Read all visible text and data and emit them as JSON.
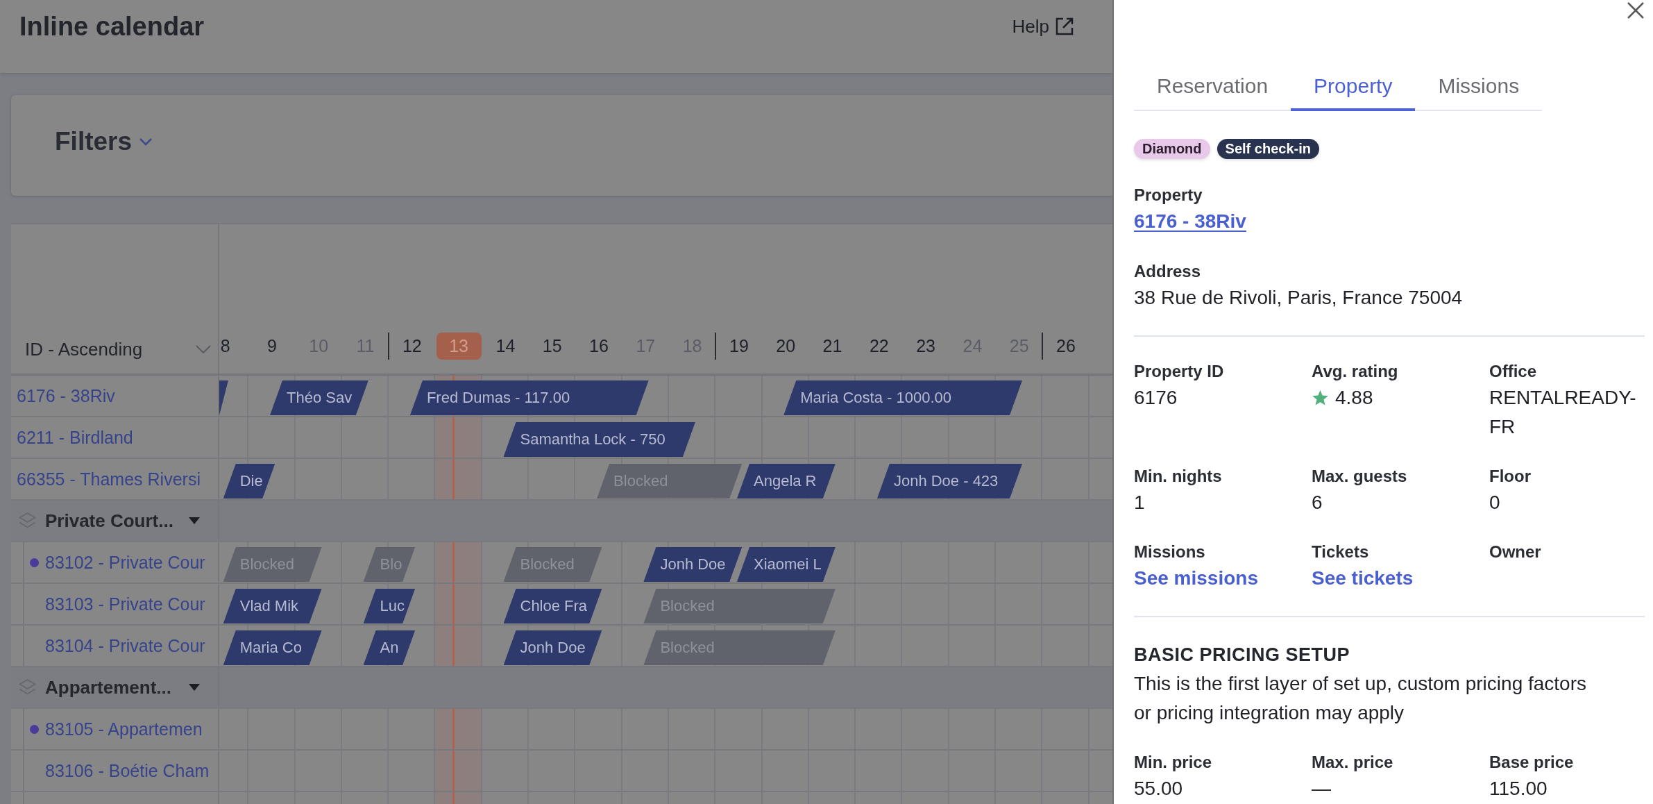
{
  "page": {
    "title": "Inline calendar",
    "help": "Help"
  },
  "filters": {
    "label": "Filters",
    "expanded": false
  },
  "calendar": {
    "sort": "ID - Ascending",
    "days": [
      {
        "label": "8",
        "weekend": false,
        "week_start": false,
        "today": false
      },
      {
        "label": "9",
        "weekend": false,
        "week_start": false,
        "today": false
      },
      {
        "label": "10",
        "weekend": true,
        "week_start": false,
        "today": false
      },
      {
        "label": "11",
        "weekend": true,
        "week_start": false,
        "today": false
      },
      {
        "label": "12",
        "weekend": false,
        "week_start": true,
        "today": false
      },
      {
        "label": "13",
        "weekend": false,
        "week_start": false,
        "today": true
      },
      {
        "label": "14",
        "weekend": false,
        "week_start": false,
        "today": false
      },
      {
        "label": "15",
        "weekend": false,
        "week_start": false,
        "today": false
      },
      {
        "label": "16",
        "weekend": false,
        "week_start": false,
        "today": false
      },
      {
        "label": "17",
        "weekend": true,
        "week_start": false,
        "today": false
      },
      {
        "label": "18",
        "weekend": true,
        "week_start": false,
        "today": false
      },
      {
        "label": "19",
        "weekend": false,
        "week_start": true,
        "today": false
      },
      {
        "label": "20",
        "weekend": false,
        "week_start": false,
        "today": false
      },
      {
        "label": "21",
        "weekend": false,
        "week_start": false,
        "today": false
      },
      {
        "label": "22",
        "weekend": false,
        "week_start": false,
        "today": false
      },
      {
        "label": "23",
        "weekend": false,
        "week_start": false,
        "today": false
      },
      {
        "label": "24",
        "weekend": true,
        "week_start": false,
        "today": false
      },
      {
        "label": "25",
        "weekend": true,
        "week_start": false,
        "today": false
      },
      {
        "label": "26",
        "weekend": false,
        "week_start": true,
        "today": false
      }
    ],
    "rows": [
      {
        "kind": "property",
        "label": "6176 - 38Riv",
        "bookings": [
          {
            "kind": "reservation"
          },
          {
            "kind": "reservation",
            "label": "Théo Sav"
          },
          {
            "kind": "reservation",
            "label": "Fred Dumas - 117.00"
          },
          {
            "kind": "reservation",
            "label": "Maria Costa - 1000.00"
          }
        ]
      },
      {
        "kind": "property",
        "label": "6211 - Birdland",
        "bookings": [
          {
            "kind": "reservation",
            "label": "Samantha Lock - 750"
          }
        ]
      },
      {
        "kind": "property",
        "label": "66355 - Thames Riversi",
        "bookings": [
          {
            "kind": "reservation",
            "label": "Die"
          },
          {
            "kind": "blocked",
            "label": "Blocked"
          },
          {
            "kind": "reservation",
            "label": "Angela R"
          },
          {
            "kind": "reservation",
            "label": "Jonh Doe - 423"
          }
        ]
      },
      {
        "kind": "group",
        "label": "Private Court...",
        "expanded": true,
        "children": [
          {
            "kind": "property",
            "label": "83102 - Private Cour",
            "dot": true,
            "bookings": [
              {
                "kind": "blocked",
                "label": "Blocked"
              },
              {
                "kind": "blocked",
                "label": "Blo"
              },
              {
                "kind": "blocked",
                "label": "Blocked"
              },
              {
                "kind": "reservation",
                "label": "Jonh Doe"
              },
              {
                "kind": "reservation",
                "label": "Xiaomei L"
              }
            ]
          },
          {
            "kind": "property",
            "label": "83103 - Private Cour",
            "dot": false,
            "bookings": [
              {
                "kind": "reservation",
                "label": "Vlad Mik"
              },
              {
                "kind": "reservation",
                "label": "Luc"
              },
              {
                "kind": "reservation",
                "label": "Chloe Fra"
              },
              {
                "kind": "blocked",
                "label": "Blocked"
              }
            ]
          },
          {
            "kind": "property",
            "label": "83104 - Private Cour",
            "dot": false,
            "bookings": [
              {
                "kind": "reservation",
                "label": "Maria Co"
              },
              {
                "kind": "reservation",
                "label": "An"
              },
              {
                "kind": "reservation",
                "label": "Jonh Doe"
              },
              {
                "kind": "blocked",
                "label": "Blocked"
              }
            ]
          }
        ]
      },
      {
        "kind": "group",
        "label": "Appartement...",
        "expanded": true,
        "children": [
          {
            "kind": "property",
            "label": "83105 - Appartemen",
            "dot": true
          },
          {
            "kind": "property",
            "label": "83106 - Boétie Cham",
            "dot": false
          }
        ]
      }
    ]
  },
  "drawer": {
    "tabs": [
      {
        "label": "Reservation",
        "selected": false
      },
      {
        "label": "Property",
        "selected": true
      },
      {
        "label": "Missions",
        "selected": false
      }
    ],
    "tags": [
      {
        "label": "Diamond",
        "color": "#e8c9e9"
      },
      {
        "label": "Self check-in",
        "color": "#29324f"
      }
    ],
    "property": {
      "label": "Property",
      "value": "6176 - 38Riv"
    },
    "address": {
      "label": "Address",
      "value": "38 Rue de Rivoli, Paris, France 75004"
    },
    "details": [
      {
        "kind": "text",
        "label": "Property ID",
        "value": "6176"
      },
      {
        "kind": "rating",
        "label": "Avg. rating",
        "value": "4.88"
      },
      {
        "kind": "text",
        "label": "Office",
        "value": "RENTALREADY-FR"
      },
      {
        "kind": "text",
        "label": "Min. nights",
        "value": "1"
      },
      {
        "kind": "text",
        "label": "Max. guests",
        "value": "6"
      },
      {
        "kind": "text",
        "label": "Floor",
        "value": "0"
      },
      {
        "kind": "link",
        "label": "Missions",
        "value": "See missions"
      },
      {
        "kind": "link",
        "label": "Tickets",
        "value": "See tickets"
      },
      {
        "kind": "text",
        "label": "Owner"
      }
    ],
    "pricing": {
      "title": "BASIC PRICING SETUP",
      "description": "This is the first layer of set up, custom pricing factors or pricing integration may apply",
      "fields": [
        {
          "label": "Min. price",
          "value": "55.00"
        },
        {
          "label": "Max. price",
          "value": "—"
        },
        {
          "label": "Base price",
          "value": "115.00"
        }
      ]
    }
  }
}
